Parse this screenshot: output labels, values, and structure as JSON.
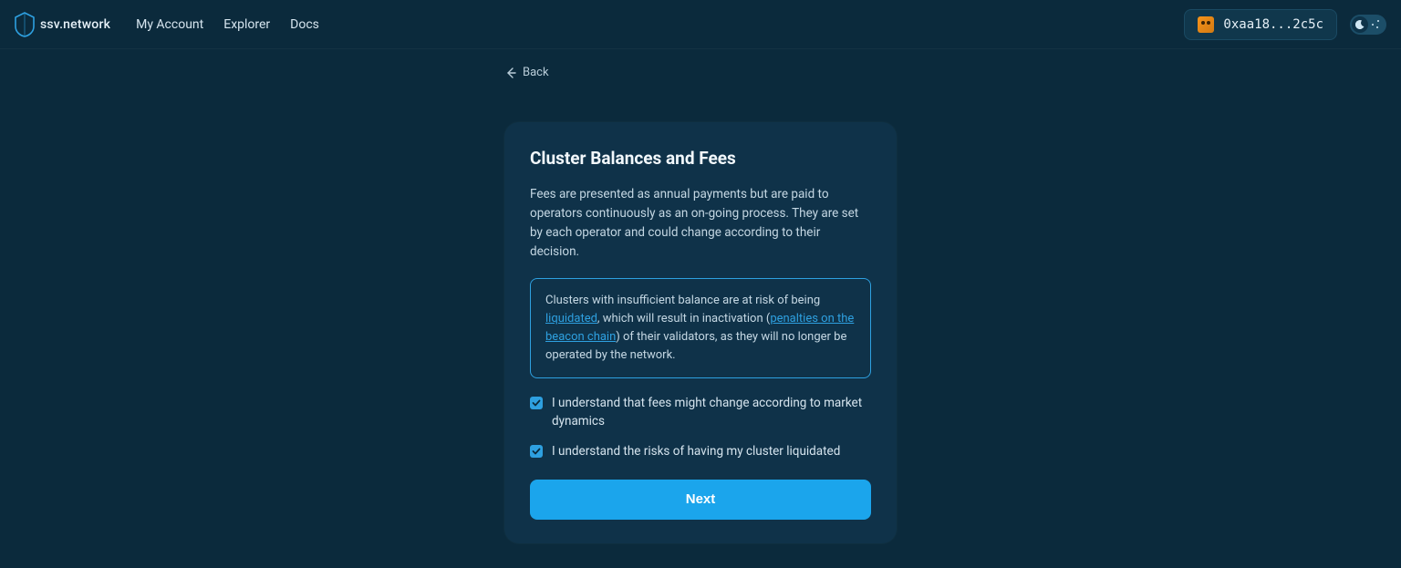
{
  "header": {
    "logo_text": "ssv.network",
    "nav": {
      "my_account": "My Account",
      "explorer": "Explorer",
      "docs": "Docs"
    },
    "wallet_address": "0xaa18...2c5c"
  },
  "back": {
    "label": "Back"
  },
  "card": {
    "title": "Cluster Balances and Fees",
    "body": "Fees are presented as annual payments but are paid to operators continuously as an on-going process. They are set by each operator and could change according to their decision.",
    "callout": {
      "pre_link1": "Clusters with insufficient balance are at risk of being ",
      "link1_text": "liquidated",
      "mid1": ", which will result in inactivation (",
      "link2_text": "penalties on the beacon chain",
      "post": ") of their validators, as they will no longer be operated by the network."
    },
    "check1": "I understand that fees might change according to market dynamics",
    "check2": "I understand the risks of having my cluster liquidated",
    "next_label": "Next"
  },
  "colors": {
    "bg": "#0b2a3c",
    "panel": "#0f3249",
    "accent": "#1ba5ec",
    "border_accent": "#2ea0e0"
  }
}
